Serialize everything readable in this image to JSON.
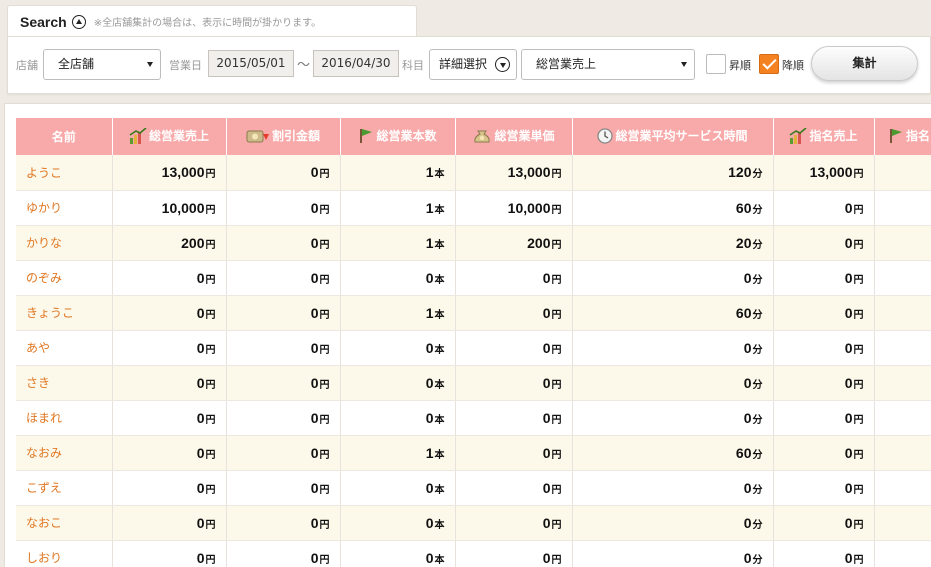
{
  "search": {
    "title": "Search",
    "note": "※全店舗集計の場合は、表示に時間が掛かります。"
  },
  "filters": {
    "store_label": "店舗",
    "store_value": "全店舗",
    "date_label": "営業日",
    "date_from": "2015/05/01",
    "date_separator": "～",
    "date_to": "2016/04/30",
    "item_label": "科目",
    "detail_button": "詳細選択",
    "metric_value": "総営業売上",
    "asc_label": "昇順",
    "desc_label": "降順",
    "asc_checked": false,
    "desc_checked": true,
    "aggregate_button": "集計"
  },
  "colors": {
    "header_bg": "#f8a9a9",
    "name_text": "#e07722",
    "odd_row_bg": "#fdf9ea",
    "checkbox_checked": "#f58220"
  },
  "table": {
    "columns": [
      {
        "label": "名前",
        "icon": ""
      },
      {
        "label": "総営業売上",
        "icon": "sales-chart-icon"
      },
      {
        "label": "割引金額",
        "icon": "discount-icon"
      },
      {
        "label": "総営業本数",
        "icon": "flag-icon"
      },
      {
        "label": "総営業単価",
        "icon": "money-bag-icon"
      },
      {
        "label": "総営業平均サービス時間",
        "icon": "clock-icon"
      },
      {
        "label": "指名売上",
        "icon": "sales-chart-icon"
      },
      {
        "label": "指名",
        "icon": "flag-icon"
      }
    ],
    "units": {
      "yen": "円",
      "count": "本",
      "minute": "分"
    },
    "rows": [
      {
        "name": "ようこ",
        "sales": "13,000",
        "discount": "0",
        "count": "1",
        "unit_price": "13,000",
        "avg_time": "120",
        "nom_sales": "13,000"
      },
      {
        "name": "ゆかり",
        "sales": "10,000",
        "discount": "0",
        "count": "1",
        "unit_price": "10,000",
        "avg_time": "60",
        "nom_sales": "0"
      },
      {
        "name": "かりな",
        "sales": "200",
        "discount": "0",
        "count": "1",
        "unit_price": "200",
        "avg_time": "20",
        "nom_sales": "0"
      },
      {
        "name": "のぞみ",
        "sales": "0",
        "discount": "0",
        "count": "0",
        "unit_price": "0",
        "avg_time": "0",
        "nom_sales": "0"
      },
      {
        "name": "きょうこ",
        "sales": "0",
        "discount": "0",
        "count": "1",
        "unit_price": "0",
        "avg_time": "60",
        "nom_sales": "0"
      },
      {
        "name": "あや",
        "sales": "0",
        "discount": "0",
        "count": "0",
        "unit_price": "0",
        "avg_time": "0",
        "nom_sales": "0"
      },
      {
        "name": "さき",
        "sales": "0",
        "discount": "0",
        "count": "0",
        "unit_price": "0",
        "avg_time": "0",
        "nom_sales": "0"
      },
      {
        "name": "ほまれ",
        "sales": "0",
        "discount": "0",
        "count": "0",
        "unit_price": "0",
        "avg_time": "0",
        "nom_sales": "0"
      },
      {
        "name": "なおみ",
        "sales": "0",
        "discount": "0",
        "count": "1",
        "unit_price": "0",
        "avg_time": "60",
        "nom_sales": "0"
      },
      {
        "name": "こずえ",
        "sales": "0",
        "discount": "0",
        "count": "0",
        "unit_price": "0",
        "avg_time": "0",
        "nom_sales": "0"
      },
      {
        "name": "なおこ",
        "sales": "0",
        "discount": "0",
        "count": "0",
        "unit_price": "0",
        "avg_time": "0",
        "nom_sales": "0"
      },
      {
        "name": "しおり",
        "sales": "0",
        "discount": "0",
        "count": "0",
        "unit_price": "0",
        "avg_time": "0",
        "nom_sales": "0"
      }
    ]
  }
}
